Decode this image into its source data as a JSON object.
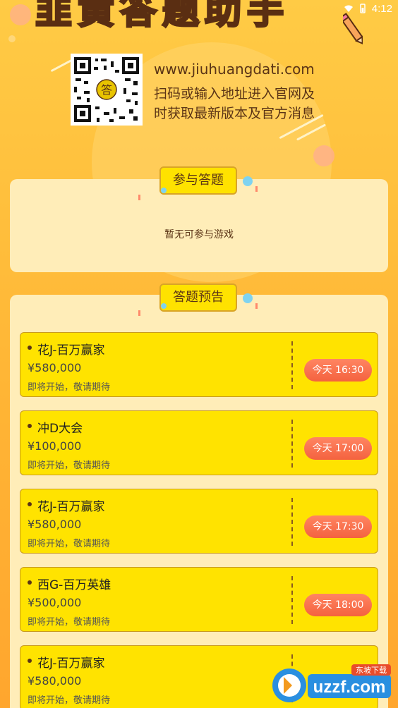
{
  "header": {
    "title": "韭黄答题助手",
    "url": "www.jiuhuangdati.com",
    "desc_line1": "扫码或输入地址进入官网及",
    "desc_line2": "时获取最新版本及官方消息",
    "qr_center": "答"
  },
  "status_bar": {
    "time": "4:12"
  },
  "current_section": {
    "tab_label": "参与答题",
    "empty_text": "暂无可参与游戏"
  },
  "upcoming_section": {
    "tab_label": "答题预告",
    "games": [
      {
        "name": "花J-百万赢家",
        "prize": "¥580,000",
        "status": "即将开始，敬请期待",
        "time": "今天 16:30"
      },
      {
        "name": "冲D大会",
        "prize": "¥100,000",
        "status": "即将开始，敬请期待",
        "time": "今天 17:00"
      },
      {
        "name": "花J-百万赢家",
        "prize": "¥580,000",
        "status": "即将开始，敬请期待",
        "time": "今天 17:30"
      },
      {
        "name": "西G-百万英雄",
        "prize": "¥500,000",
        "status": "即将开始，敬请期待",
        "time": "今天 18:00"
      },
      {
        "name": "花J-百万赢家",
        "prize": "¥580,000",
        "status": "即将开始，敬请期待",
        "time": ""
      }
    ]
  },
  "watermark": {
    "brand": "uzzf.com",
    "sub": "东坡下载"
  },
  "colors": {
    "accent": "#FFE300",
    "button": "#F4623F",
    "text_brown": "#5B3416"
  }
}
